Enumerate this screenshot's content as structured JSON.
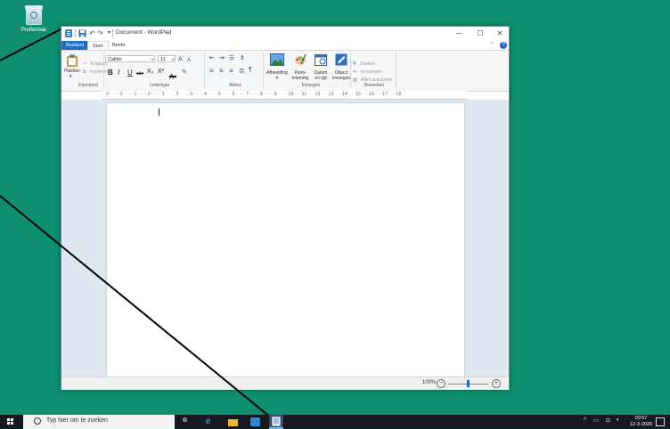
{
  "desktop": {
    "recycle_bin_label": "Prullenbak"
  },
  "window": {
    "title": "Document - WordPad",
    "quick_access": {
      "dropdown": "▾"
    },
    "controls": {
      "minimize": "─",
      "maximize": "☐",
      "close": "✕"
    }
  },
  "ribbon": {
    "tabs": [
      "Bestand",
      "Start",
      "Beeld"
    ],
    "collapse": "^",
    "help": "?",
    "clipboard": {
      "paste_label": "Plakken",
      "cut_label": "Knippen",
      "copy_label": "Kopiëren",
      "group_label": "Klembord"
    },
    "font": {
      "family": "Calibri",
      "size": "11",
      "grow": "A",
      "shrink": "A",
      "bold": "B",
      "italic": "I",
      "underline": "U",
      "strike": "abc",
      "subscript": "X₂",
      "superscript": "X²",
      "group_label": "Lettertype"
    },
    "paragraph": {
      "group_label": "Alinea"
    },
    "insert": {
      "picture_label": "Afbeelding",
      "paint_label_1": "Paint-",
      "paint_label_2": "tekening",
      "datetime_label_1": "Datum",
      "datetime_label_2": "en tijd",
      "object_label_1": "Object",
      "object_label_2": "invoegen",
      "group_label": "Invoegen"
    },
    "edit": {
      "find_label": "Zoeken",
      "replace_label": "Vervangen",
      "select_all_label": "Alles selecteren",
      "group_label": "Bewerken"
    }
  },
  "ruler": {
    "text": "3 · · · 2 · · · 1 · · · 0 · · · 1 · · · 2 · · · 3 · · · 4 · · · 5 · · · 6 · · · 7 · · · 8 · · · 9 · · · 10 · · 11 · · 12 · · 13 · · 14 · · 15 · · 16 · · 17 · · 18"
  },
  "status": {
    "zoom": "100%",
    "zoom_out": "−",
    "zoom_in": "+",
    "zoom_level": 0.5
  },
  "taskbar": {
    "search_placeholder": "Typ hier om te zoeken",
    "time": "09:57",
    "date": "12-3-2020",
    "tray_chevron": "^"
  },
  "colors": {
    "desktop": "#0f8f6f",
    "accent": "#1f6cc1",
    "taskbar": "#141a20"
  }
}
